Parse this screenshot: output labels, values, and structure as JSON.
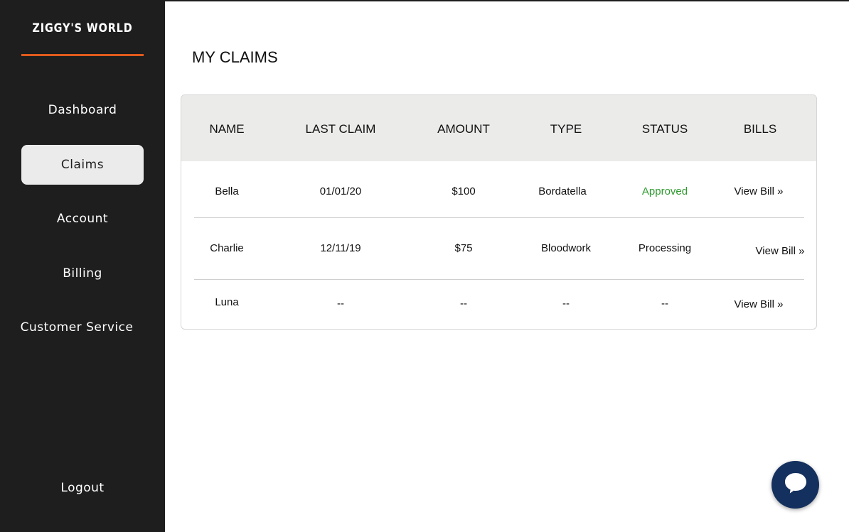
{
  "sidebar": {
    "brand": "ZIGGY'S WORLD",
    "items": [
      {
        "label": "Dashboard"
      },
      {
        "label": "Claims"
      },
      {
        "label": "Account"
      },
      {
        "label": "Billing"
      },
      {
        "label": "Customer Service"
      }
    ],
    "logout": "Logout"
  },
  "main": {
    "title": "MY CLAIMS",
    "table": {
      "headers": [
        "NAME",
        "LAST CLAIM",
        "AMOUNT",
        "TYPE",
        "STATUS",
        "BILLS"
      ],
      "rows": [
        {
          "name": "Bella",
          "last_claim": "01/01/20",
          "amount": "$100",
          "type": "Bordatella",
          "status": "Approved",
          "bill": "View Bill  »"
        },
        {
          "name": "Charlie",
          "last_claim": "12/11/19",
          "amount": "$75",
          "type": "Bloodwork",
          "status": "Processing",
          "bill": "View Bill  »"
        },
        {
          "name": "Luna",
          "last_claim": "--",
          "amount": "--",
          "type": "--",
          "status": "--",
          "bill": "View Bill  »"
        }
      ]
    }
  },
  "colors": {
    "sidebar_bg": "#1e1e1e",
    "accent": "#e05a1c",
    "approved": "#2e9a2e",
    "chat_button": "#14305e"
  },
  "chat": {
    "icon": "chat-bubble-icon"
  }
}
